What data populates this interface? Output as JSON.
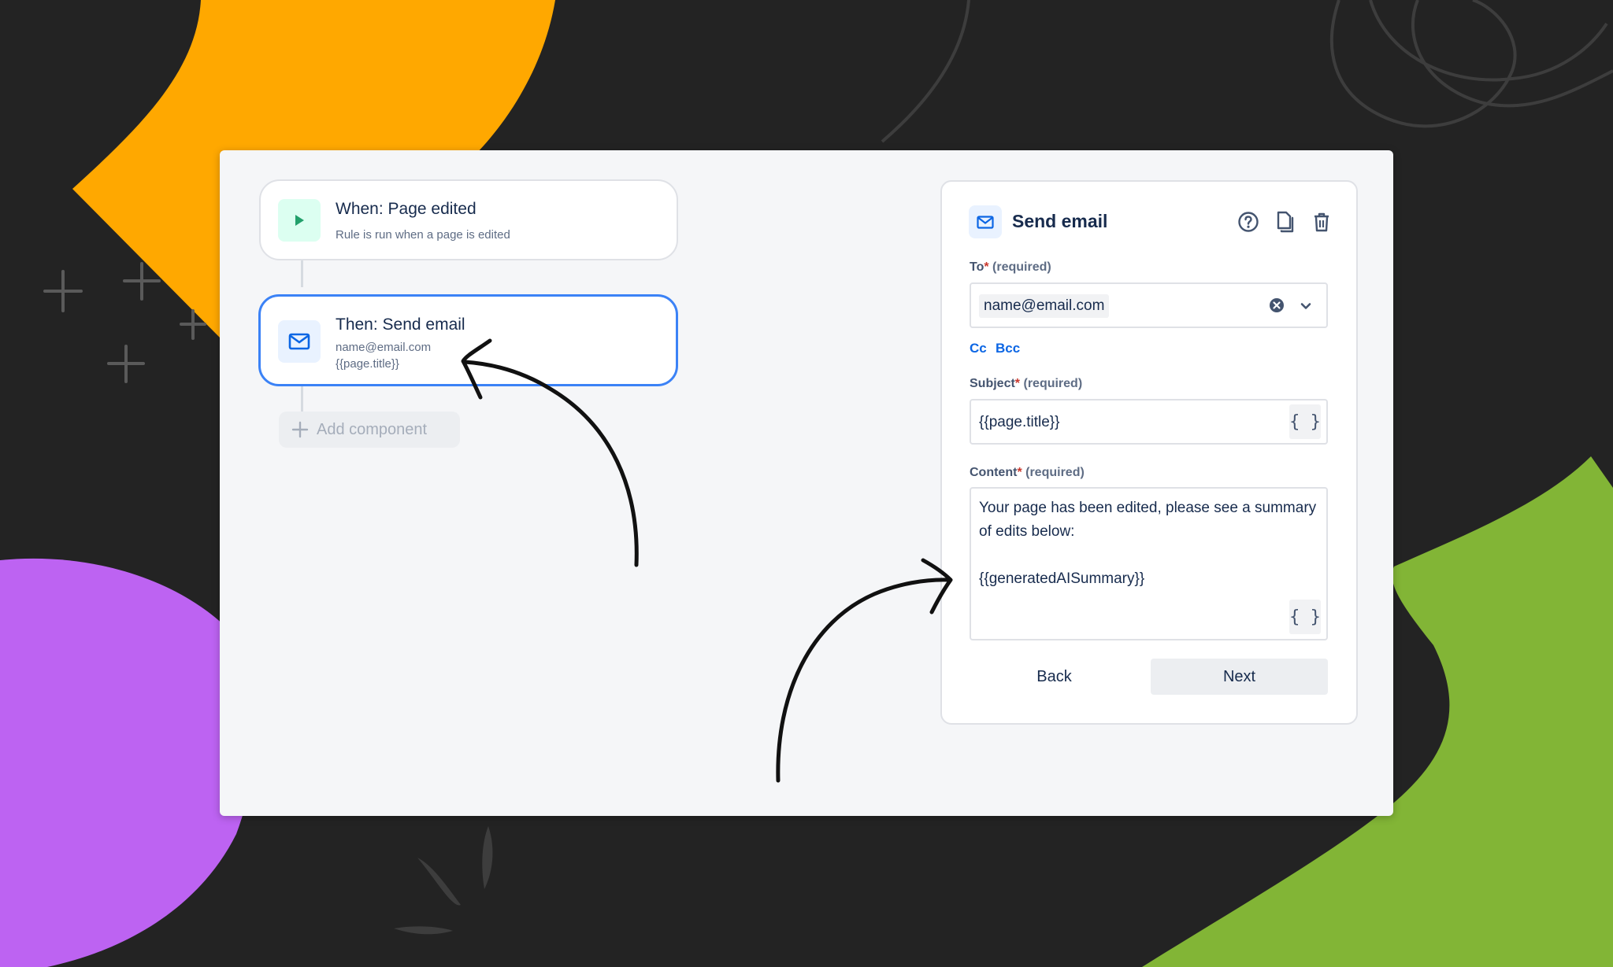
{
  "colors": {
    "background": "#232323",
    "orange_blob": "#ffa800",
    "purple_blob": "#bd63f2",
    "green_blob": "#82b536",
    "selected_border": "#3b82f6",
    "link": "#0c66e4"
  },
  "flow": {
    "trigger": {
      "icon": "play-icon",
      "title": "When: Page edited",
      "subtitle": "Rule is run when a page is edited"
    },
    "action": {
      "icon": "mail-icon",
      "title": "Then: Send email",
      "line1": "name@email.com",
      "line2": "{{page.title}}"
    },
    "add_component_label": "Add component"
  },
  "panel": {
    "icon": "mail-icon",
    "title": "Send email",
    "actions": [
      "help-icon",
      "copy-icon",
      "trash-icon"
    ],
    "to": {
      "label": "To",
      "required_mark": "*",
      "hint": "(required)",
      "value": "name@email.com"
    },
    "cc_label": "Cc",
    "bcc_label": "Bcc",
    "subject": {
      "label": "Subject",
      "required_mark": "*",
      "hint": "(required)",
      "value": "{{page.title}}"
    },
    "content": {
      "label": "Content",
      "required_mark": "*",
      "hint": "(required)",
      "value": "Your page has been edited, please see a summary of edits below:\n\n{{generatedAISummary}}"
    },
    "variable_button_label": "{ }",
    "back_label": "Back",
    "next_label": "Next"
  }
}
